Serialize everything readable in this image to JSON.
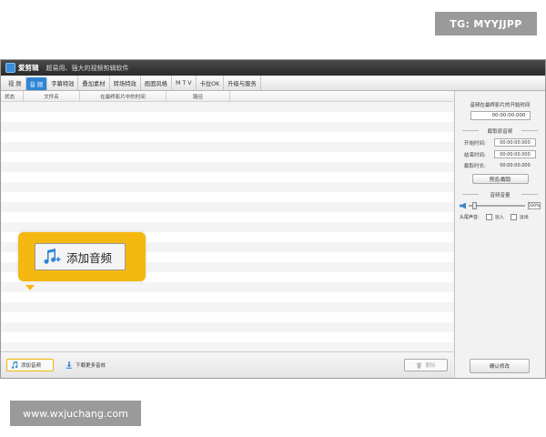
{
  "watermarks": {
    "top": "TG: MYYJJPP",
    "bottom": "www.wxjuchang.com"
  },
  "app": {
    "name": "爱剪辑",
    "subtitle": "超易用、强大的视频剪辑软件"
  },
  "tabs": [
    {
      "label": "视 频",
      "active": false
    },
    {
      "label": "音 频",
      "active": true
    },
    {
      "label": "字幕特效",
      "active": false
    },
    {
      "label": "叠加素材",
      "active": false
    },
    {
      "label": "转场特效",
      "active": false
    },
    {
      "label": "画面风格",
      "active": false
    },
    {
      "label": "M T V",
      "active": false
    },
    {
      "label": "卡拉OK",
      "active": false
    },
    {
      "label": "升级与服务",
      "active": false
    }
  ],
  "table": {
    "columns": [
      "状态",
      "文件名",
      "在最终影片中的时间",
      "路径"
    ]
  },
  "callout": {
    "label": "添加音频",
    "icon": "music-note-plus-icon"
  },
  "bottom_bar": {
    "add_label": "添加音频",
    "download_label": "下载更多音效",
    "delete_label": "删除"
  },
  "side": {
    "start_time_title": "音频在最终影片的开始时间",
    "start_time_value": "00:00:00.000",
    "clip_heading": "截取原音频",
    "start_label": "开始时间:",
    "start_value": "00:00:00.000",
    "end_label": "结束时间:",
    "end_value": "00:00:00.000",
    "duration_label": "截取时长:",
    "duration_value": "00:00:00.000",
    "preview_button": "预览/截取",
    "volume_heading": "音频音量",
    "volume_percent": "100%",
    "volume_level": 0.1,
    "fade_label": "头尾声音:",
    "fade_in_label": "淡入",
    "fade_out_label": "淡出",
    "confirm_button": "确认修改"
  }
}
